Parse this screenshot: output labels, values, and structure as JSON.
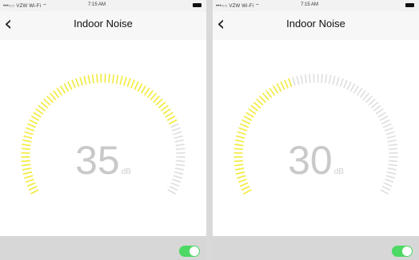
{
  "colors": {
    "active_tick": "#f3ea3c",
    "inactive_tick": "#dedede",
    "toggle_on": "#4cd964"
  },
  "screens": [
    {
      "status": {
        "signal": "•••○○ VZW Wi-Fi ⌔",
        "time": "7:15 AM"
      },
      "nav": {
        "back_icon": "‹",
        "title": "Indoor Noise"
      },
      "reading": {
        "value": "35",
        "unit": "dB"
      },
      "gauge": {
        "active_fraction": 0.78
      },
      "bottom": {
        "label": "",
        "toggle_on": true
      }
    },
    {
      "status": {
        "signal": "•••○○ VZW Wi-Fi ⌔",
        "time": "7:15 AM"
      },
      "nav": {
        "back_icon": "‹",
        "title": "Indoor Noise"
      },
      "reading": {
        "value": "30",
        "unit": "dB"
      },
      "gauge": {
        "active_fraction": 0.42
      },
      "bottom": {
        "label": "",
        "toggle_on": true
      }
    }
  ]
}
